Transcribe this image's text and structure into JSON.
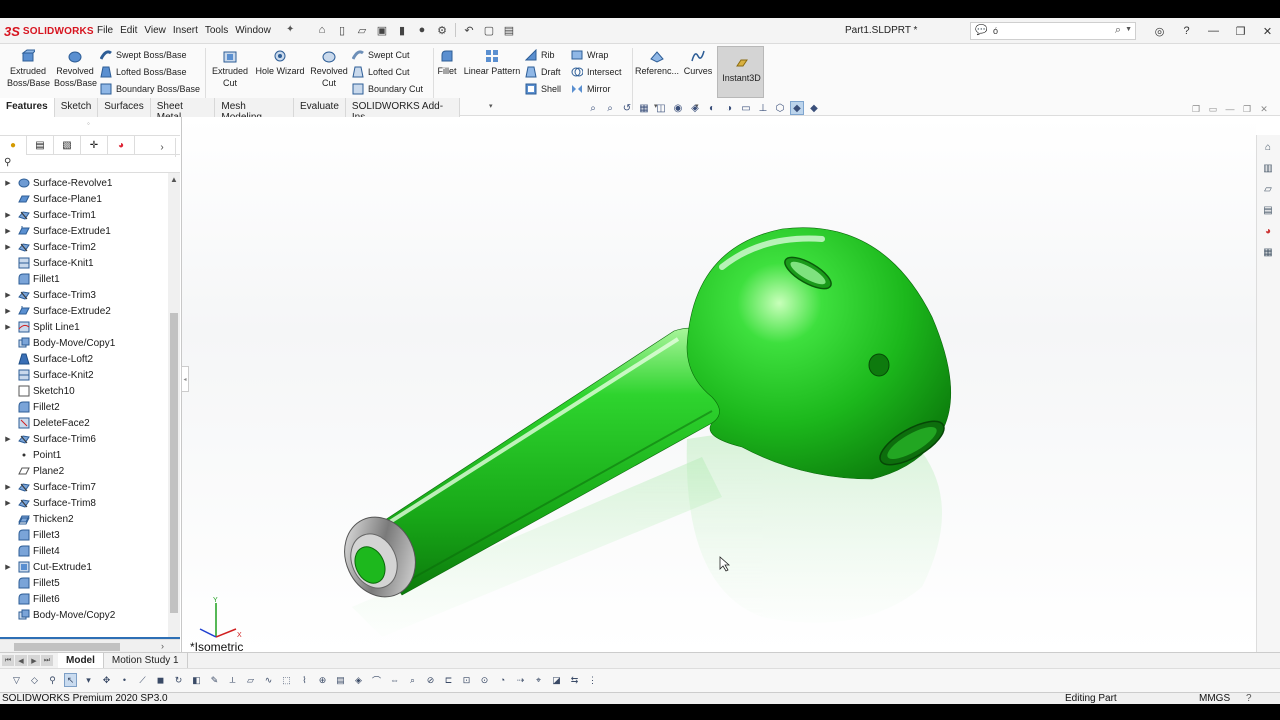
{
  "app": {
    "brand": "SOLIDWORKS",
    "document_title": "Part1.SLDPRT *",
    "search_value": "ó"
  },
  "menu": [
    "File",
    "Edit",
    "View",
    "Insert",
    "Tools",
    "Window"
  ],
  "commands": {
    "extruded_boss": "Extruded Boss/Base",
    "revolved_boss": "Revolved Boss/Base",
    "swept_boss": "Swept Boss/Base",
    "lofted_boss": "Lofted Boss/Base",
    "boundary_boss": "Boundary Boss/Base",
    "extruded_cut": "Extruded Cut",
    "hole_wizard": "Hole Wizard",
    "revolved_cut": "Revolved Cut",
    "swept_cut": "Swept Cut",
    "lofted_cut": "Lofted Cut",
    "boundary_cut": "Boundary Cut",
    "fillet": "Fillet",
    "linear_pattern": "Linear Pattern",
    "rib": "Rib",
    "draft": "Draft",
    "shell": "Shell",
    "wrap": "Wrap",
    "intersect": "Intersect",
    "mirror": "Mirror",
    "reference": "Referenc...",
    "curves": "Curves",
    "instant3d": "Instant3D"
  },
  "tabs": [
    "Features",
    "Sketch",
    "Surfaces",
    "Sheet Metal",
    "Mesh Modeling",
    "Evaluate",
    "SOLIDWORKS Add-Ins"
  ],
  "tree": [
    {
      "label": "Surface-Revolve1",
      "expandable": true,
      "icon": "revolve-icon"
    },
    {
      "label": "Surface-Plane1",
      "expandable": false,
      "icon": "surface-plane-icon"
    },
    {
      "label": "Surface-Trim1",
      "expandable": true,
      "icon": "trim-icon"
    },
    {
      "label": "Surface-Extrude1",
      "expandable": true,
      "icon": "surface-extrude-icon"
    },
    {
      "label": "Surface-Trim2",
      "expandable": true,
      "icon": "trim-icon"
    },
    {
      "label": "Surface-Knit1",
      "expandable": false,
      "icon": "knit-icon"
    },
    {
      "label": "Fillet1",
      "expandable": false,
      "icon": "fillet-icon"
    },
    {
      "label": "Surface-Trim3",
      "expandable": true,
      "icon": "trim-icon"
    },
    {
      "label": "Surface-Extrude2",
      "expandable": true,
      "icon": "surface-extrude-icon"
    },
    {
      "label": "Split Line1",
      "expandable": true,
      "icon": "split-line-icon"
    },
    {
      "label": "Body-Move/Copy1",
      "expandable": false,
      "icon": "move-copy-icon"
    },
    {
      "label": "Surface-Loft2",
      "expandable": false,
      "icon": "loft-icon"
    },
    {
      "label": "Surface-Knit2",
      "expandable": false,
      "icon": "knit-icon"
    },
    {
      "label": "Sketch10",
      "expandable": false,
      "icon": "sketch-icon"
    },
    {
      "label": "Fillet2",
      "expandable": false,
      "icon": "fillet-icon"
    },
    {
      "label": "DeleteFace2",
      "expandable": false,
      "icon": "delete-face-icon"
    },
    {
      "label": "Surface-Trim6",
      "expandable": true,
      "icon": "trim-icon"
    },
    {
      "label": "Point1",
      "expandable": false,
      "icon": "point-icon"
    },
    {
      "label": "Plane2",
      "expandable": false,
      "icon": "plane-icon"
    },
    {
      "label": "Surface-Trim7",
      "expandable": true,
      "icon": "trim-icon"
    },
    {
      "label": "Surface-Trim8",
      "expandable": true,
      "icon": "trim-icon"
    },
    {
      "label": "Thicken2",
      "expandable": false,
      "icon": "thicken-icon"
    },
    {
      "label": "Fillet3",
      "expandable": false,
      "icon": "fillet-icon"
    },
    {
      "label": "Fillet4",
      "expandable": false,
      "icon": "fillet-icon"
    },
    {
      "label": "Cut-Extrude1",
      "expandable": true,
      "icon": "cut-extrude-icon"
    },
    {
      "label": "Fillet5",
      "expandable": false,
      "icon": "fillet-icon"
    },
    {
      "label": "Fillet6",
      "expandable": false,
      "icon": "fillet-icon"
    },
    {
      "label": "Body-Move/Copy2",
      "expandable": false,
      "icon": "move-copy-icon"
    }
  ],
  "view": {
    "orientation": "*Isometric",
    "model_color": "#1fbf1f"
  },
  "bottom_tabs": [
    "Model",
    "Motion Study 1"
  ],
  "status": {
    "product": "SOLIDWORKS Premium 2020 SP3.0",
    "mode": "Editing Part",
    "units": "MMGS",
    "help": "?"
  }
}
